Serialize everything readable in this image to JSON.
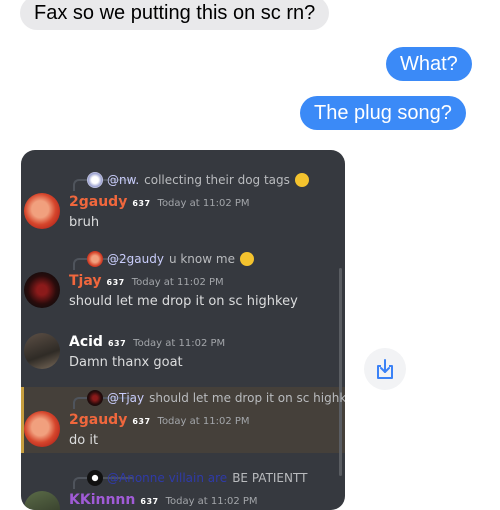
{
  "messages": [
    {
      "text": "Fax so we putting this on sc rn?"
    },
    {
      "text": "What?"
    },
    {
      "text": "The plug song?"
    }
  ],
  "discord": {
    "messages": [
      {
        "reply_to": "@nw.",
        "reply_text": "collecting their dog tags",
        "reply_emoji": "thinking-face",
        "author": "2gaudy",
        "badge": "637",
        "timestamp": "Today at 11:02 PM",
        "content": "bruh",
        "author_color": "#f0673d"
      },
      {
        "reply_to": "@2gaudy",
        "reply_text": "u know me",
        "reply_emoji": "winking-face",
        "author": "Tjay",
        "badge": "637",
        "timestamp": "Today at 11:02 PM",
        "content": "should let me drop it on sc highkey",
        "author_color": "#f0673d"
      },
      {
        "author": "Acid",
        "badge": "637",
        "timestamp": "Today at 11:02 PM",
        "content": "Damn thanx goat",
        "author_color": "#ffffff"
      },
      {
        "reply_to": "@Tjay",
        "reply_text": "should let me drop it on sc highkey",
        "author": "2gaudy",
        "badge": "637",
        "timestamp": "Today at 11:02 PM",
        "content": "do it",
        "author_color": "#f0673d",
        "highlighted": true
      },
      {
        "reply_to": "@Anonne villain are",
        "reply_text": "BE PATIENTT",
        "author": "KKinnnn",
        "badge": "637",
        "timestamp": "Today at 11:02 PM"
      }
    ],
    "colors": {
      "mention": "#c9cdfb",
      "author_orange": "#f0673d",
      "highlight_border": "#c79f3f"
    }
  },
  "share_button": {
    "icon": "share-icon"
  }
}
